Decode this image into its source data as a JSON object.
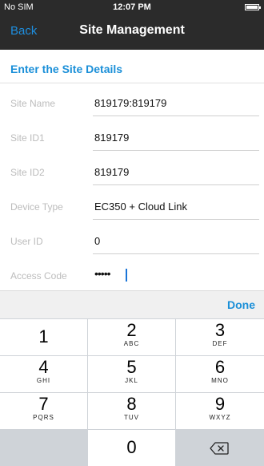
{
  "status_bar": {
    "carrier": "No SIM",
    "time": "12:07 PM"
  },
  "nav": {
    "back_label": "Back",
    "title": "Site Management"
  },
  "section_title": "Enter the Site Details",
  "fields": [
    {
      "label": "Site Name",
      "value": "819179:819179"
    },
    {
      "label": "Site ID1",
      "value": "819179"
    },
    {
      "label": "Site ID2",
      "value": "819179"
    },
    {
      "label": "Device Type",
      "value": "EC350 + Cloud Link"
    },
    {
      "label": "User ID",
      "value": "0"
    },
    {
      "label": "Access Code",
      "value": "•••••"
    }
  ],
  "accessory": {
    "done_label": "Done"
  },
  "keypad": {
    "keys": [
      {
        "num": "1",
        "letters": ""
      },
      {
        "num": "2",
        "letters": "ABC"
      },
      {
        "num": "3",
        "letters": "DEF"
      },
      {
        "num": "4",
        "letters": "GHI"
      },
      {
        "num": "5",
        "letters": "JKL"
      },
      {
        "num": "6",
        "letters": "MNO"
      },
      {
        "num": "7",
        "letters": "PQRS"
      },
      {
        "num": "8",
        "letters": "TUV"
      },
      {
        "num": "9",
        "letters": "WXYZ"
      },
      {
        "num": "0",
        "letters": ""
      }
    ],
    "delete_icon": "backspace-icon"
  }
}
